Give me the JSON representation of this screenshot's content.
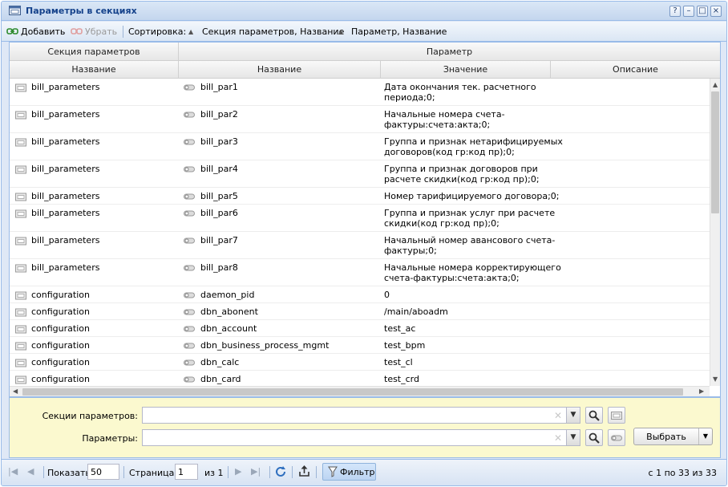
{
  "window": {
    "title": "Параметры в секциях",
    "controls": [
      "?",
      "–",
      "□",
      "×"
    ]
  },
  "toolbar": {
    "add_label": "Добавить",
    "remove_label": "Убрать",
    "sort_label": "Сортировка:",
    "sort1_label": "Секция параметров, Название",
    "sort2_label": "Параметр, Название"
  },
  "grid": {
    "group_headers": [
      "Секция параметров",
      "Параметр"
    ],
    "columns": [
      "Название",
      "Название",
      "Значение",
      "Описание"
    ],
    "rows": [
      {
        "section": "bill_parameters",
        "name": "bill_par1",
        "value": [
          "Дата окончания тек. расчетного",
          "периода;0;"
        ],
        "desc": ""
      },
      {
        "section": "bill_parameters",
        "name": "bill_par2",
        "value": [
          "Начальные номера счета-",
          "фактуры:счета:акта;0;"
        ],
        "desc": ""
      },
      {
        "section": "bill_parameters",
        "name": "bill_par3",
        "value": [
          "Группа и признак нетарифицируемых",
          "договоров(код гр:код пр);0;"
        ],
        "desc": ""
      },
      {
        "section": "bill_parameters",
        "name": "bill_par4",
        "value": [
          "Группа и признак договоров при",
          "расчете скидки(код гр:код пр);0;"
        ],
        "desc": ""
      },
      {
        "section": "bill_parameters",
        "name": "bill_par5",
        "value": [
          "Номер тарифицируемого договора;0;"
        ],
        "desc": ""
      },
      {
        "section": "bill_parameters",
        "name": "bill_par6",
        "value": [
          "Группа и признак услуг при расчете",
          "скидки(код гр:код пр);0;"
        ],
        "desc": ""
      },
      {
        "section": "bill_parameters",
        "name": "bill_par7",
        "value": [
          "Начальный номер авансового счета-",
          "фактуры;0;"
        ],
        "desc": ""
      },
      {
        "section": "bill_parameters",
        "name": "bill_par8",
        "value": [
          "Начальные номера корректирующего",
          "счета-фактуры:счета:акта;0;"
        ],
        "desc": ""
      },
      {
        "section": "configuration",
        "name": "daemon_pid",
        "value": [
          "0"
        ],
        "desc": ""
      },
      {
        "section": "configuration",
        "name": "dbn_abonent",
        "value": [
          "/main/aboadm"
        ],
        "desc": ""
      },
      {
        "section": "configuration",
        "name": "dbn_account",
        "value": [
          "test_ac"
        ],
        "desc": ""
      },
      {
        "section": "configuration",
        "name": "dbn_business_process_mgmt",
        "value": [
          "test_bpm"
        ],
        "desc": ""
      },
      {
        "section": "configuration",
        "name": "dbn_calc",
        "value": [
          "test_cl"
        ],
        "desc": ""
      },
      {
        "section": "configuration",
        "name": "dbn_card",
        "value": [
          "test_crd"
        ],
        "desc": ""
      }
    ]
  },
  "filter": {
    "sections_label": "Секции параметров:",
    "params_label": "Параметры:",
    "sections_value": "",
    "params_value": "",
    "select_label": "Выбрать"
  },
  "pager": {
    "show_label": "Показать",
    "page_size": "50",
    "page_label": "Страница",
    "page": "1",
    "of_label": "из 1",
    "filter_label": "Фильтр",
    "summary": "с 1 по 33 из 33"
  },
  "colors": {
    "title_text": "#15428b",
    "border": "#99bbe8",
    "filter_bg": "#fbf9cf"
  }
}
